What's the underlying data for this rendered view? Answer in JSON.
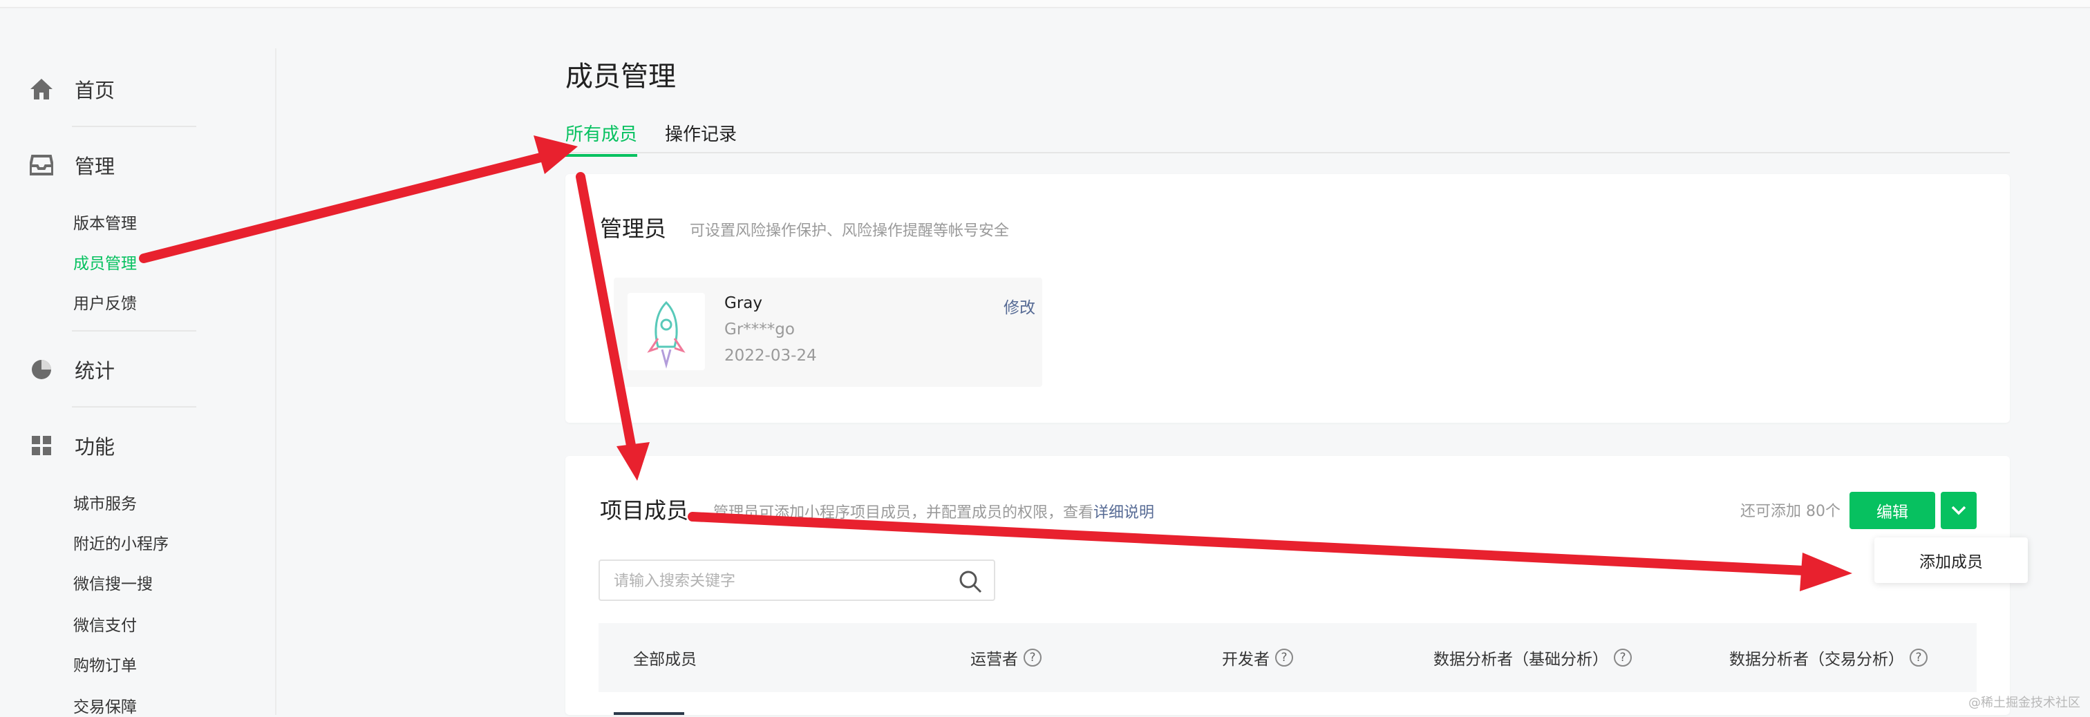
{
  "sidebar": {
    "groups": [
      {
        "label": "首页",
        "icon": "home-icon"
      },
      {
        "label": "管理",
        "icon": "inbox-icon",
        "items": [
          "版本管理",
          "成员管理",
          "用户反馈"
        ]
      },
      {
        "label": "统计",
        "icon": "pie-chart-icon"
      },
      {
        "label": "功能",
        "icon": "grid-icon",
        "items": [
          "城市服务",
          "附近的小程序",
          "微信搜一搜",
          "微信支付",
          "购物订单",
          "交易保障"
        ]
      }
    ],
    "active_item": "成员管理"
  },
  "page": {
    "title": "成员管理",
    "tabs": [
      "所有成员",
      "操作记录"
    ]
  },
  "admin_card": {
    "title": "管理员",
    "desc": "可设置风险操作保护、风险操作提醒等帐号安全",
    "admin": {
      "name": "Gray",
      "id": "Gr****go",
      "date": "2022-03-24",
      "edit_label": "修改"
    }
  },
  "members_card": {
    "title": "项目成员",
    "desc": "管理员可添加小程序项目成员，并配置成员的权限，查看",
    "desc_link": "详细说明",
    "quota": "还可添加 80个",
    "edit_button": "编辑",
    "search_placeholder": "请输入搜索关键字",
    "columns": [
      "全部成员",
      "运营者",
      "开发者",
      "数据分析者（基础分析）",
      "数据分析者（交易分析）"
    ],
    "help_symbol": "?"
  },
  "dropdown": {
    "item": "添加成员"
  },
  "watermark": "@稀土掘金技术社区",
  "colors": {
    "accent": "#07c160",
    "link": "#576b95",
    "arrow": "#e8212e"
  }
}
